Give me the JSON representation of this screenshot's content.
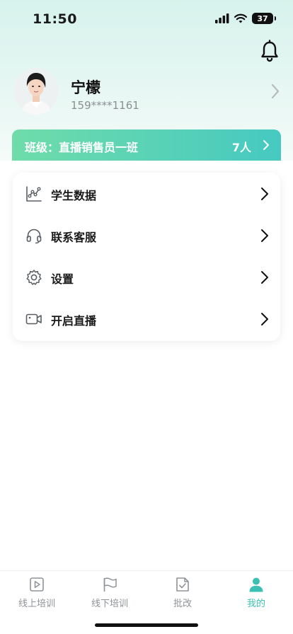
{
  "status_bar": {
    "time": "11:50",
    "battery": "37"
  },
  "profile": {
    "name": "宁檬",
    "phone": "159****1161"
  },
  "class_bar": {
    "label": "班级：直播销售员一班",
    "count": "7人"
  },
  "menu": {
    "items": [
      {
        "label": "学生数据",
        "icon": "chart-icon"
      },
      {
        "label": "联系客服",
        "icon": "headset-icon"
      },
      {
        "label": "设置",
        "icon": "gear-icon"
      },
      {
        "label": "开启直播",
        "icon": "video-camera-icon"
      }
    ]
  },
  "tabbar": {
    "items": [
      {
        "label": "线上培训",
        "icon": "play-icon"
      },
      {
        "label": "线下培训",
        "icon": "flag-icon"
      },
      {
        "label": "批改",
        "icon": "doc-check-icon"
      },
      {
        "label": "我的",
        "icon": "user-icon"
      }
    ],
    "active_index": 3
  },
  "colors": {
    "accent": "#3cc0b4",
    "gradient_start": "#6fdcaa",
    "gradient_end": "#46c9c1"
  }
}
